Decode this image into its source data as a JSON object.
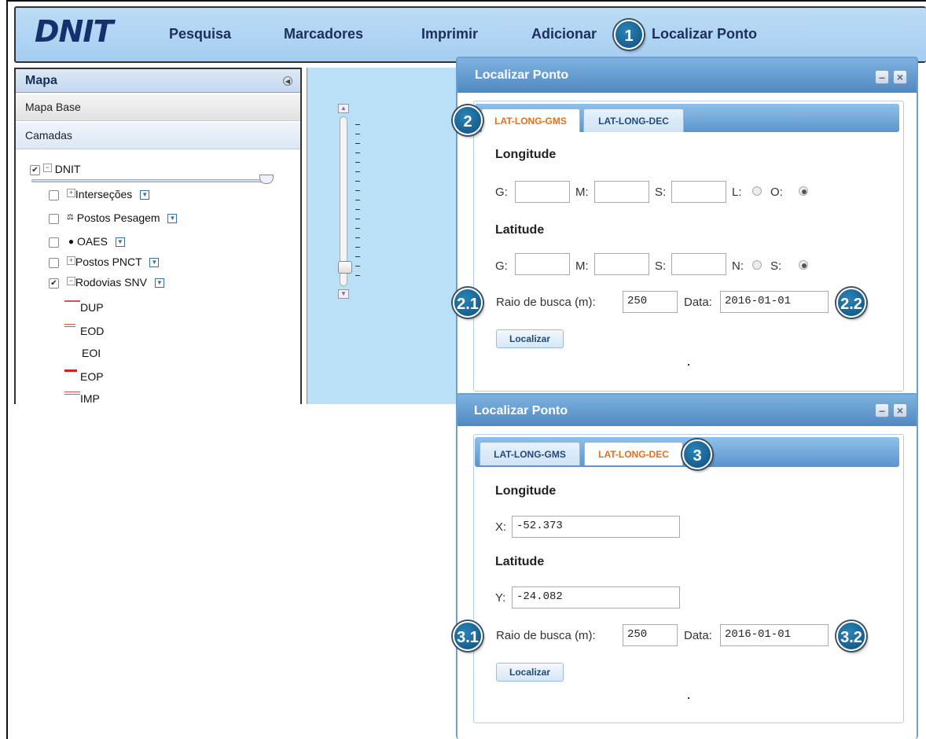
{
  "app": {
    "logo": "DNIT"
  },
  "nav": {
    "items": [
      {
        "label": "Pesquisa"
      },
      {
        "label": "Marcadores"
      },
      {
        "label": "Imprimir"
      },
      {
        "label": "Adicionar"
      },
      {
        "label": "Localizar Ponto"
      }
    ]
  },
  "callouts": {
    "c1": "1",
    "c2": "2",
    "c21": "2.1",
    "c22": "2.2",
    "c3": "3",
    "c31": "3.1",
    "c32": "3.2"
  },
  "sidebar": {
    "title": "Mapa",
    "sections": [
      {
        "label": "Mapa Base"
      },
      {
        "label": "Camadas"
      }
    ],
    "tree": {
      "root": {
        "label": "DNIT",
        "checked": true
      },
      "children": [
        {
          "label": "Interseções",
          "checked": false
        },
        {
          "label": "Postos Pesagem",
          "checked": false
        },
        {
          "label": "OAES",
          "checked": false
        },
        {
          "label": "Postos PNCT",
          "checked": false
        },
        {
          "label": "Rodovias SNV",
          "checked": true
        }
      ],
      "legend": [
        {
          "label": "DUP",
          "color": "#d9534f"
        },
        {
          "label": "EOD",
          "color": "#d9534f"
        },
        {
          "label": "EOI",
          "color": ""
        },
        {
          "label": "EOP",
          "color": "#d81e1e"
        },
        {
          "label": "IMP",
          "color": "#d9534f"
        }
      ]
    }
  },
  "dialog_gms": {
    "title": "Localizar Ponto",
    "tabs": [
      {
        "label": "LAT-LONG-GMS",
        "active": true
      },
      {
        "label": "LAT-LONG-DEC",
        "active": false
      }
    ],
    "longitude": {
      "heading": "Longitude",
      "g_label": "G:",
      "m_label": "M:",
      "s_label": "S:",
      "g": "",
      "m": "",
      "s": "",
      "opt1": "L:",
      "opt2": "O:",
      "selected": "O:"
    },
    "latitude": {
      "heading": "Latitude",
      "g_label": "G:",
      "m_label": "M:",
      "s_label": "S:",
      "g": "",
      "m": "",
      "s": "",
      "opt1": "N:",
      "opt2": "S:",
      "selected": "S:"
    },
    "radius_label": "Raio de busca (m):",
    "radius": "250",
    "date_label": "Data:",
    "date": "2016-01-01",
    "submit": "Localizar",
    "minimize": "–",
    "close": "×"
  },
  "dialog_dec": {
    "title": "Localizar Ponto",
    "tabs": [
      {
        "label": "LAT-LONG-GMS",
        "active": false
      },
      {
        "label": "LAT-LONG-DEC",
        "active": true
      }
    ],
    "longitude": {
      "heading": "Longitude",
      "x_label": "X:",
      "x": "-52.373"
    },
    "latitude": {
      "heading": "Latitude",
      "y_label": "Y:",
      "y": "-24.082"
    },
    "radius_label": "Raio de busca (m):",
    "radius": "250",
    "date_label": "Data:",
    "date": "2016-01-01",
    "submit": "Localizar",
    "minimize": "–",
    "close": "×"
  },
  "colors": {
    "accent": "#4f88c2",
    "active_tab": "#e0701c",
    "header_bg": "#a6cdf0",
    "badge": "#0e4f7c"
  }
}
